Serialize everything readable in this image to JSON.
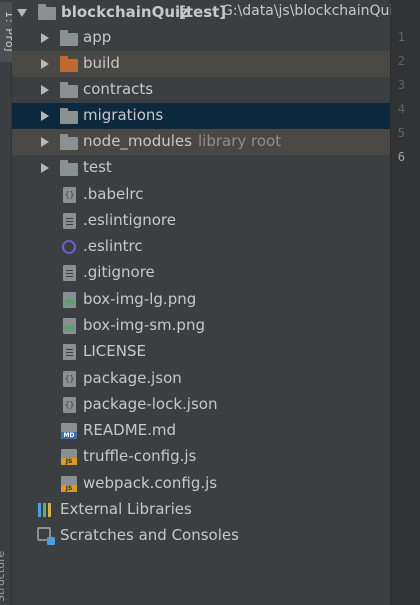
{
  "side_strip": {
    "top_label": "1: Proj",
    "bottom_label": "Structure"
  },
  "project": {
    "name": "blockchainQuiz",
    "module": "[test]",
    "path": "G:\\data\\js\\blockchainQuiz"
  },
  "folders": [
    {
      "label": "app"
    },
    {
      "label": "build"
    },
    {
      "label": "contracts"
    },
    {
      "label": "migrations"
    },
    {
      "label": "node_modules",
      "note": "library root"
    },
    {
      "label": "test"
    }
  ],
  "files": [
    {
      "label": ".babelrc",
      "icon": "json-file-icon"
    },
    {
      "label": ".eslintignore",
      "icon": "text-file-icon"
    },
    {
      "label": ".eslintrc",
      "icon": "eslint-icon"
    },
    {
      "label": ".gitignore",
      "icon": "text-file-icon"
    },
    {
      "label": "box-img-lg.png",
      "icon": "image-file-icon"
    },
    {
      "label": "box-img-sm.png",
      "icon": "image-file-icon"
    },
    {
      "label": "LICENSE",
      "icon": "text-file-icon"
    },
    {
      "label": "package.json",
      "icon": "json-file-icon"
    },
    {
      "label": "package-lock.json",
      "icon": "json-file-icon"
    },
    {
      "label": "README.md",
      "icon": "markdown-file-icon",
      "badge": "MD"
    },
    {
      "label": "truffle-config.js",
      "icon": "js-file-icon",
      "badge": "JS"
    },
    {
      "label": "webpack.config.js",
      "icon": "js-file-icon",
      "badge": "JS"
    }
  ],
  "extra": {
    "external_libraries": "External Libraries",
    "scratches": "Scratches and Consoles"
  },
  "gutter": {
    "lines": [
      "1",
      "2",
      "3",
      "4",
      "5",
      "6"
    ],
    "current_line": "6"
  },
  "colors": {
    "selection": "#0d293e",
    "excluded_row": "#4a4845",
    "build_folder": "#c06a2f",
    "eslint": "#6a5fd0"
  }
}
